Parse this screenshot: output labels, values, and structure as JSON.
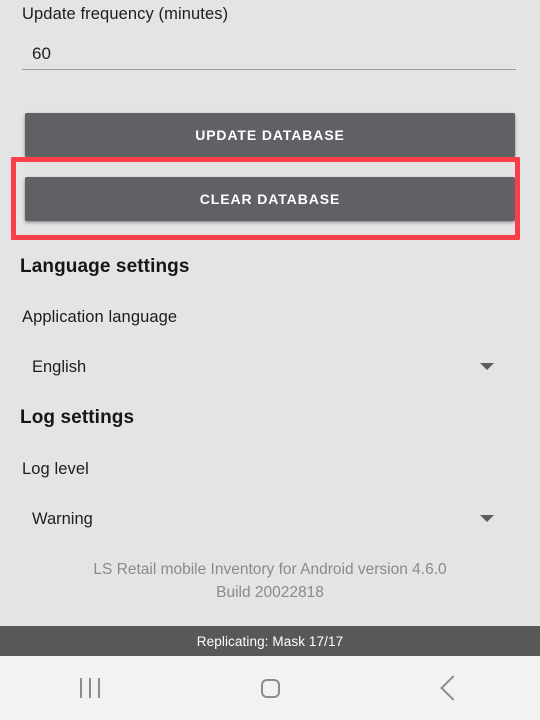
{
  "app": {
    "background_color": "#e4e4e4",
    "button_color": "#5f6164",
    "highlight_color": "#f9404a",
    "status_bar_color": "#585858"
  },
  "update_section": {
    "frequency_label": "Update frequency (minutes)",
    "frequency_value": "60",
    "frequency_placeholder": "60",
    "update_button_label": "UPDATE DATABASE",
    "clear_button_label": "CLEAR DATABASE"
  },
  "language_section": {
    "header": "Language settings",
    "field_label": "Application language",
    "selected_value": "English",
    "dropdown_icon": "chevron-down-icon"
  },
  "log_section": {
    "header": "Log settings",
    "field_label": "Log level",
    "selected_value": "Warning",
    "dropdown_icon": "chevron-down-icon"
  },
  "footer": {
    "version_line": "LS Retail mobile Inventory for Android version 4.6.0",
    "build_line": "Build 20022818"
  },
  "status_bar": {
    "text": "Replicating: Mask 17/17"
  },
  "nav_bar": {
    "recents_icon": "recents-icon",
    "home_icon": "home-icon",
    "back_icon": "back-icon"
  }
}
